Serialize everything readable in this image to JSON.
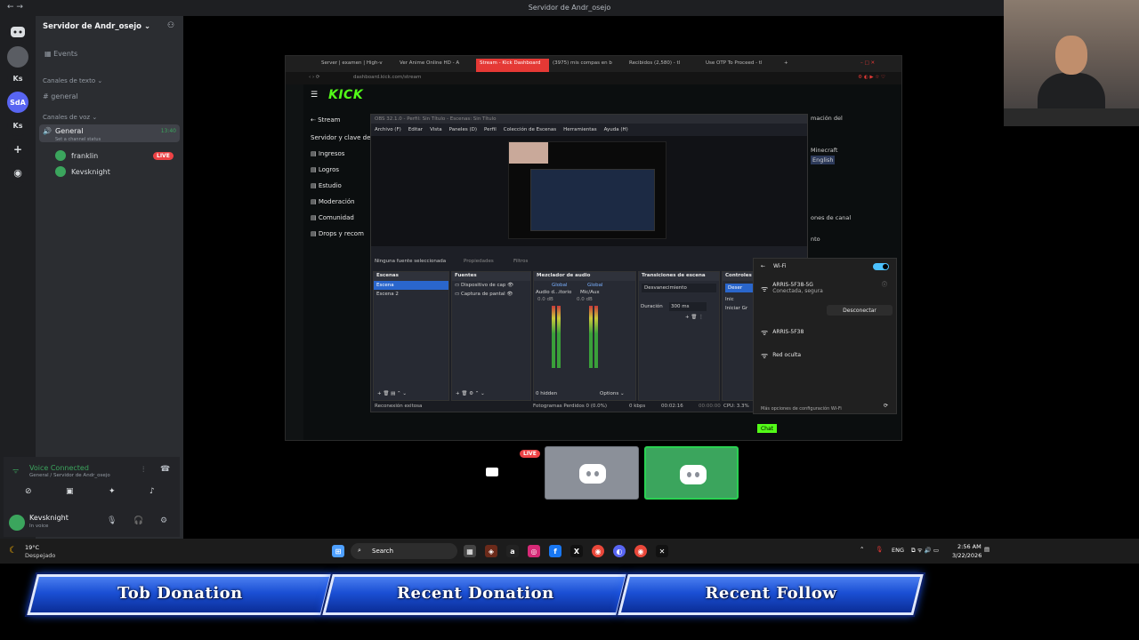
{
  "discord": {
    "window_title": "Servidor de Andr_osejo",
    "server_name": "Servidor de Andr_osejo",
    "rail_labels": [
      "Ks",
      "SdA",
      "Ks"
    ],
    "events": "Events",
    "text_category": "Canales de texto",
    "text_channel": "general",
    "voice_category": "Canales de voz",
    "voice_channel": "General",
    "voice_time": "13:40",
    "channel_status": "Set a channel status",
    "voice_users": [
      {
        "name": "franklin",
        "badge": "LIVE"
      },
      {
        "name": "Kevsknight",
        "badge": ""
      }
    ],
    "voice_connected": "Voice Connected",
    "voice_location": "General / Servidor de Andr_osejo",
    "user_name": "Kevsknight",
    "user_status": "In voice"
  },
  "browser": {
    "tabs": [
      "Server | examen | High-v",
      "Ver Anime Online HD - A",
      "Stream - Kick Dashboard",
      "(3975) mis compas en b",
      "Recibidos (2,580) - tl",
      "Use OTP To Proceed - tl"
    ],
    "url": "dashboard.kick.com/stream",
    "kick_logo": "KICK",
    "kick_nav": {
      "stream": "Stream",
      "server_key": "Servidor y clave de",
      "items": [
        "Ingresos",
        "Logros",
        "Estudio",
        "Moderación",
        "Comunidad",
        "Drops y recom"
      ]
    },
    "right_ghost": [
      "mación del",
      "Minecraft",
      "English",
      "ones de canal",
      "nto"
    ],
    "chat_label": "Chat"
  },
  "obs": {
    "title": "OBS 32.1.0 - Perfil: Sin Título - Escenas: Sin Título",
    "menu": [
      "Archivo (F)",
      "Editar",
      "Vista",
      "Paneles (D)",
      "Perfil",
      "Colección de Escenas",
      "Herramientas",
      "Ayuda (H)"
    ],
    "no_source": "Ninguna fuente seleccionada",
    "properties": "Propiedades",
    "filters": "Filtros",
    "docks": {
      "scenes": {
        "title": "Escenas",
        "items": [
          "Escena",
          "Escena 2"
        ]
      },
      "sources": {
        "title": "Fuentes",
        "items": [
          "Dispositivo de cap",
          "Captura de pantal"
        ]
      },
      "mixer": {
        "title": "Mezclador de audio",
        "channels": [
          "Audio d...itorio",
          "Mic/Aux"
        ],
        "global": "Global",
        "db": "0.0 dB",
        "hidden": "0 hidden",
        "options": "Options"
      },
      "transitions": {
        "title": "Transiciones de escena",
        "type": "Desvanecimiento",
        "duration_label": "Duración",
        "duration": "300 ms"
      },
      "controls": {
        "title": "Controles",
        "items": [
          "Deser",
          "Inic",
          "Iniciar Gr"
        ]
      }
    },
    "status": {
      "reconnect": "Reconexión exitosa",
      "dropped": "Fotogramas Perdidos 0 (0.0%)",
      "kbps": "0 kbps",
      "stream_time": "00:02:16",
      "rec_time": "00:00:00",
      "cpu": "CPU: 3.3%"
    }
  },
  "wifi": {
    "title": "Wi-Fi",
    "networks": [
      {
        "name": "ARRIS-5F38-5G",
        "detail": "Conectada, segura"
      },
      {
        "name": "ARRIS-5F38",
        "detail": ""
      },
      {
        "name": "Red oculta",
        "detail": ""
      }
    ],
    "disconnect": "Desconectar",
    "more_settings": "Más opciones de configuración Wi-Fi"
  },
  "tiles": {
    "live_badge": "LIVE"
  },
  "taskbar": {
    "temp": "19°C",
    "weather": "Despejado",
    "search": "Search",
    "lang": "ENG",
    "time": "2:56 AM",
    "date": "3/22/2026"
  },
  "banners": [
    "Tob Donation",
    "Recent Donation",
    "Recent Follow"
  ],
  "colors": {
    "discord_green": "#3ba55d",
    "kick_green": "#53fc18",
    "obs_select": "#2a66cc",
    "banner_blue": "#1a4fd4",
    "wifi_accent": "#4cc2ff"
  }
}
